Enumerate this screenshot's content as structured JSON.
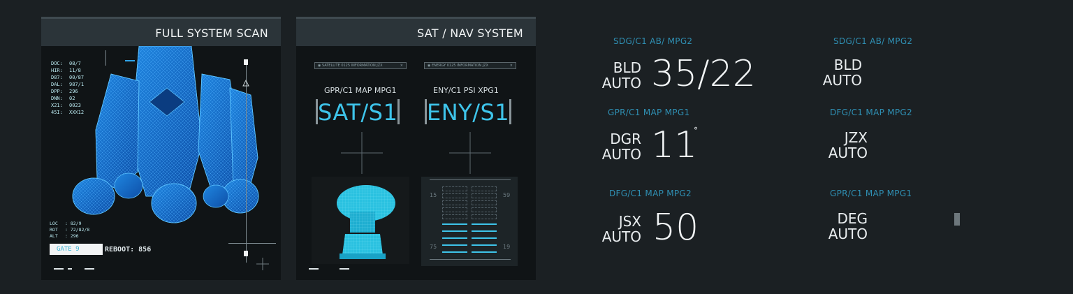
{
  "panel_scan": {
    "title": "FULL SYSTEM SCAN",
    "readouts": [
      {
        "key": "DOC:",
        "value": "08/7"
      },
      {
        "key": "HIR:",
        "value": "11/8"
      },
      {
        "key": "D87:",
        "value": "00/87"
      },
      {
        "key": "DAL:",
        "value": "987/1"
      },
      {
        "key": "DPP:",
        "value": "296"
      },
      {
        "key": "DNN:",
        "value": "02"
      },
      {
        "key": "X21:",
        "value": "0023"
      },
      {
        "key": "45I:",
        "value": "XXX12"
      }
    ],
    "location": [
      {
        "key": "LOC",
        "value": ": 82/9"
      },
      {
        "key": "ROT",
        "value": ": 72/82/8"
      },
      {
        "key": "ALT",
        "value": ": 296"
      }
    ],
    "gate": "GATE 9",
    "reboot": "REBOOT: 856",
    "rocket_icon": "rocket-wireframe-icon",
    "accent": "#2fa4e8"
  },
  "panel_nav": {
    "title": "SAT / NAV SYSTEM",
    "left": {
      "infobar": "SATELLITE 0125   INFORMATION JZX",
      "subheader": "GPR/C1   MAP  MPG1",
      "code": "SAT/S1",
      "image_icon": "satellite-dish-icon"
    },
    "right": {
      "infobar": "ENERGY 0125       INFORMATION JZX",
      "subheader": "ENY/C1   PSI  XPG1",
      "code": "ENY/S1",
      "gauge_numbers": {
        "top_left": "15",
        "top_right": "59",
        "bottom_left": "75",
        "bottom_right": "19"
      },
      "energy_level": 0.45
    },
    "code_color": "#3ec4ea"
  },
  "readouts": [
    {
      "tag": "SDG/C1   AB/  MPG2",
      "label1": "BLD",
      "label2": "AUTO",
      "value": "35/22"
    },
    {
      "tag": "GPR/C1   MAP   MPG1",
      "label1": "DGR",
      "label2": "AUTO",
      "value": "11",
      "unit": "°"
    },
    {
      "tag": "DFG/C1   MAP   MPG2",
      "label1": "JSX",
      "label2": "AUTO",
      "value": "50"
    },
    {
      "tag": "SDG/C1   AB/  MPG2",
      "label1": "BLD",
      "label2": "AUTO",
      "value": ""
    },
    {
      "tag": "DFG/C1   MAP   MPG2",
      "label1": "JZX",
      "label2": "AUTO",
      "value": ""
    },
    {
      "tag": "GPR/C1   MAP   MPG1",
      "label1": "DEG",
      "label2": "AUTO",
      "value": ""
    }
  ],
  "tag_color": "#2f8fb3"
}
